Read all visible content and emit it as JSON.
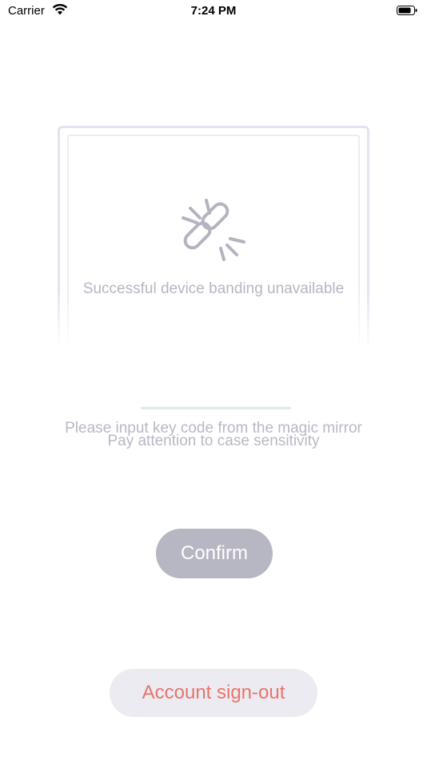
{
  "status_bar": {
    "carrier": "Carrier",
    "time": "7:24 PM",
    "wifi_icon": "wifi-icon",
    "battery_icon": "battery-icon"
  },
  "mirror_card": {
    "icon": "broken-link-icon",
    "message": "Successful device banding unavailable"
  },
  "key_input": {
    "value": "",
    "hint_line1": "Please input key code from the magic mirror",
    "hint_line2": "Pay attention to case sensitivity"
  },
  "buttons": {
    "confirm_label": "Confirm",
    "signout_label": "Account sign-out"
  },
  "colors": {
    "confirm_bg": "#b7b6c3",
    "signout_text": "#e8756b",
    "signout_bg": "#ebebf1",
    "hint_text": "#b8b8c6",
    "input_underline": "#d9efe8"
  }
}
